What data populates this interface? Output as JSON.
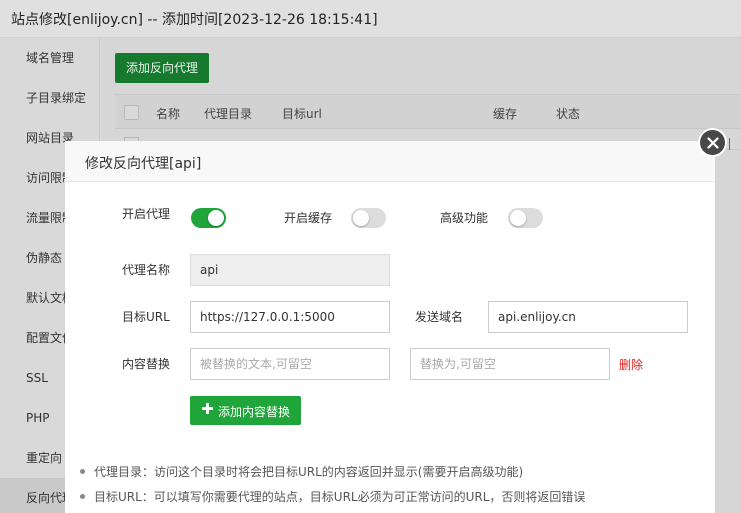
{
  "window": {
    "title": "站点修改[enlijoy.cn] -- 添加时间[2023-12-26 18:15:41]"
  },
  "sidebar": {
    "items": [
      {
        "label": "域名管理"
      },
      {
        "label": "子目录绑定"
      },
      {
        "label": "网站目录"
      },
      {
        "label": "访问限制"
      },
      {
        "label": "流量限制"
      },
      {
        "label": "伪静态"
      },
      {
        "label": "默认文档"
      },
      {
        "label": "配置文件"
      },
      {
        "label": "SSL"
      },
      {
        "label": "PHP"
      },
      {
        "label": "重定向"
      },
      {
        "label": "反向代理"
      }
    ],
    "active_index": 11
  },
  "proxy_list": {
    "add_button": "添加反向代理",
    "columns": {
      "name": "名称",
      "proxy_dir": "代理目录",
      "target_url": "目标url",
      "cache": "缓存",
      "status": "状态"
    }
  },
  "modal": {
    "title": "修改反向代理[api]",
    "enable_proxy": {
      "label": "开启代理",
      "on": true
    },
    "enable_cache": {
      "label": "开启缓存",
      "on": false
    },
    "advanced": {
      "label": "高级功能",
      "on": false
    },
    "proxy_name": {
      "label": "代理名称",
      "value": "api"
    },
    "target_url": {
      "label": "目标URL",
      "value": "https://127.0.0.1:5000"
    },
    "send_domain": {
      "label": "发送域名",
      "value": "api.enlijoy.cn"
    },
    "content_replace": {
      "label": "内容替换",
      "from_placeholder": "被替换的文本,可留空",
      "to_placeholder": "替换为,可留空",
      "delete_label": "删除"
    },
    "add_replace_button": "添加内容替换",
    "notes": [
      "代理目录：访问这个目录时将会把目标URL的内容返回并显示(需要开启高级功能)",
      "目标URL：可以填写你需要代理的站点，目标URL必须为可正常访问的URL，否则将返回错误"
    ]
  },
  "colors": {
    "accent_green": "#20a53a",
    "danger_red": "#e02020"
  },
  "icons": {
    "close": "close-icon",
    "add": "plus-icon"
  }
}
